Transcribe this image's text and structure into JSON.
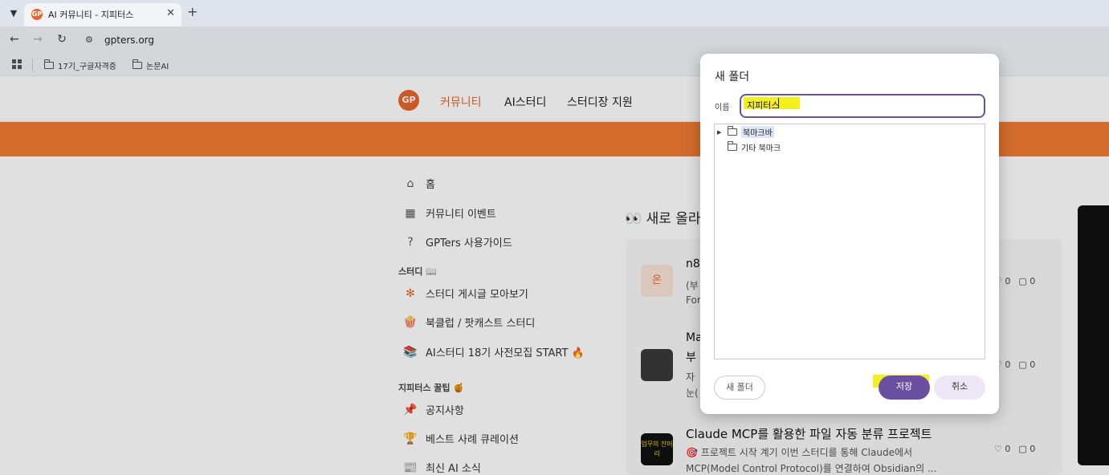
{
  "browser": {
    "tab_title": "AI 커뮤니티 - 지피터스",
    "tab_favicon_text": "GP",
    "url": "gpters.org",
    "bookmarks": [
      "17기_구글자격증",
      "논문AI"
    ]
  },
  "site": {
    "logo_text": "GP",
    "nav": [
      "커뮤니티",
      "AI스터디",
      "스터디장 지원"
    ],
    "sidebar": {
      "items": [
        "홈",
        "커뮤니티 이벤트",
        "GPTers 사용가이드"
      ],
      "study_heading": "스터디 📖",
      "study_items": [
        "스터디 게시글 모아보기",
        "북클럽 / 팟캐스트 스터디",
        "AI스터디 18기 사전모집 START 🔥"
      ],
      "tips_heading": "지피터스 꿀팁 🍯",
      "tips_items": [
        "공지사항",
        "베스트 사례 큐레이션",
        "최신 AI 소식"
      ]
    },
    "feed": {
      "title": "👀 새로 올라",
      "posts": [
        {
          "avatar_text": "온",
          "title": "n8",
          "snippet1": "(부",
          "snippet2": "For",
          "likes": "0",
          "comments": "0"
        },
        {
          "avatar_text": "",
          "title": "Ma",
          "snippet1": "부",
          "snippet2": "자",
          "snippet3": "눈(",
          "likes": "0",
          "comments": "0"
        },
        {
          "avatar_text": "업무의 잔머리",
          "title": "Claude MCP를 활용한 파일 자동 분류 프로젝트",
          "snippet1": "🎯 프로젝트 시작 계기 이번 스터디를 통해 Claude에서",
          "snippet2": "MCP(Model Control Protocol)를 연결하여 Obsidian의 ...",
          "likes": "0",
          "comments": "0"
        }
      ]
    }
  },
  "dialog": {
    "title": "새 폴더",
    "name_label": "이름",
    "name_value": "지피터스",
    "tree": [
      {
        "label": "북마크바",
        "selected": true,
        "has_children": true
      },
      {
        "label": "기타 북마크",
        "selected": false,
        "has_children": false
      }
    ],
    "new_folder_button": "새 폴더",
    "save_button": "저장",
    "cancel_button": "취소",
    "accent_color": "#6b4fa0"
  }
}
